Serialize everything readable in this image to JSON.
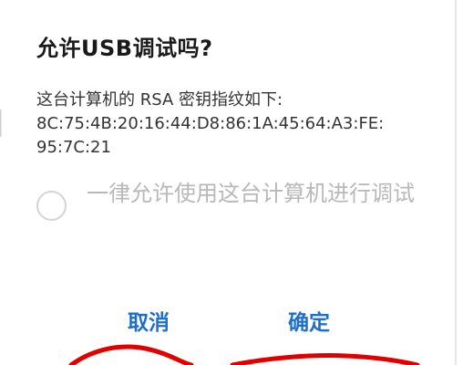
{
  "dialog": {
    "title": "允许USB调试吗?",
    "message_line1": "这台计算机的 RSA 密钥指纹如下:",
    "message_line2": "8C:75:4B:20:16:44:D8:86:1A:45:64:A3:FE:",
    "message_line3": "95:7C:21",
    "always_allow_label": "一律允许使用这台计算机进行调试",
    "always_allow_checked": false,
    "cancel_label": "取消",
    "confirm_label": "确定"
  },
  "colors": {
    "button_text": "#1f6fc8",
    "title_text": "#1a1a1a",
    "disabled_text": "#b8b8b8",
    "annotation_stroke": "#e00000"
  },
  "icons": {
    "always_allow_control": "radio-circle-icon"
  }
}
